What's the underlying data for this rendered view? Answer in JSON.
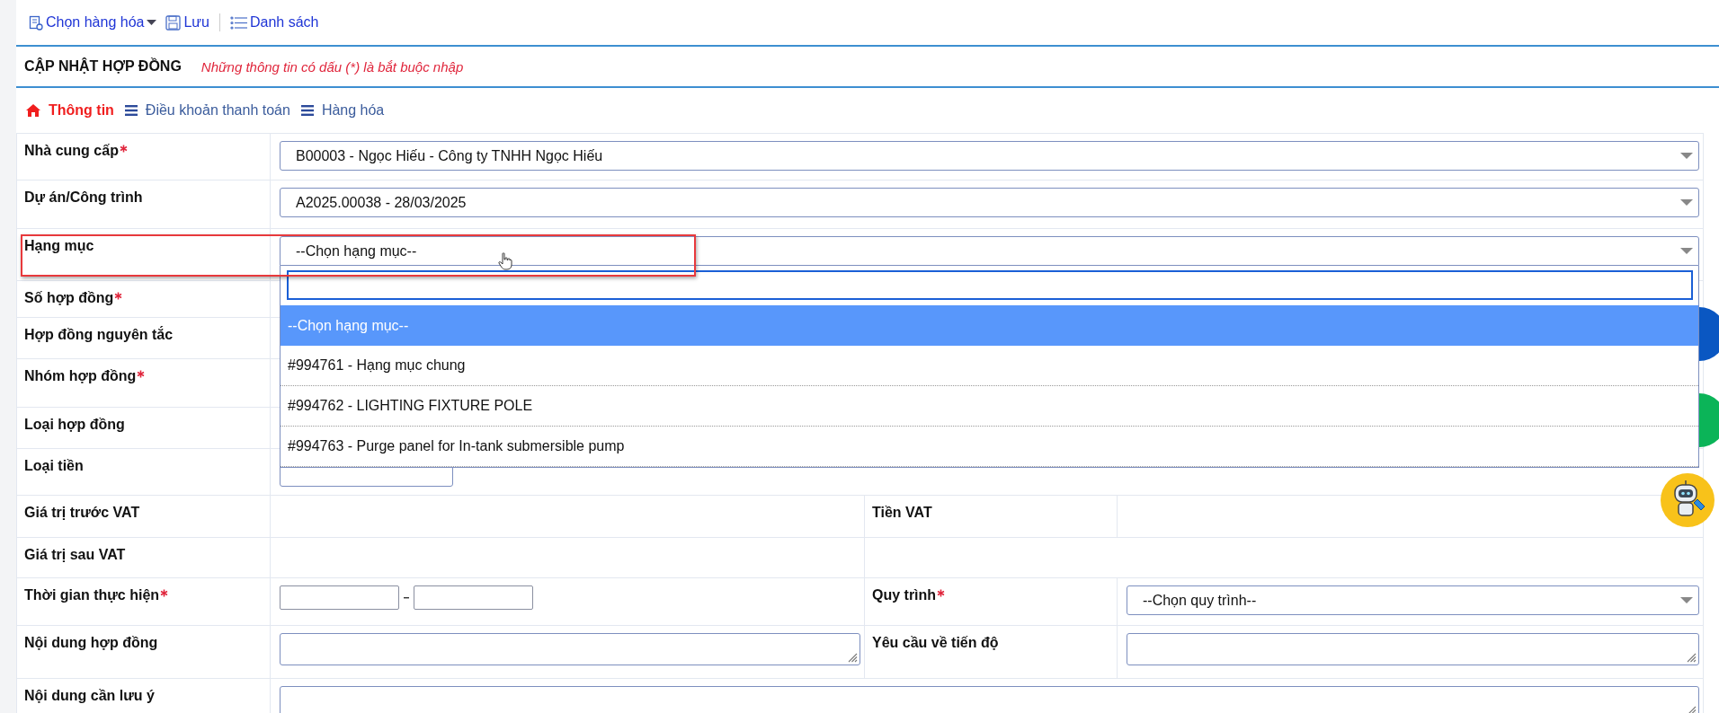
{
  "toolbar": [
    {
      "label": "Chọn hàng hóa",
      "kind": "menu"
    },
    {
      "label": "Lưu",
      "kind": "save"
    },
    {
      "label": "Danh sách",
      "kind": "list"
    }
  ],
  "header": {
    "title": "CẬP NHẬT HỢP ĐỒNG",
    "note": "Những thông tin có dấu (*) là bắt buộc nhập"
  },
  "tabs": [
    {
      "label": "Thông tin",
      "kind": "home",
      "selected": true
    },
    {
      "label": "Điều khoản thanh toán",
      "kind": "list",
      "selected": false
    },
    {
      "label": "Hàng hóa",
      "kind": "list",
      "selected": false
    }
  ],
  "form": {
    "rows": [
      {
        "label": "Nhà cung cấp",
        "required": true,
        "highlighted": false,
        "kind": "wide",
        "field": {
          "kind": "select",
          "open": false,
          "value": "B00003 - Ngọc Hiếu - Công ty TNHH Ngọc Hiếu"
        }
      },
      {
        "label": "Dự án/Công trình",
        "required": false,
        "highlighted": false,
        "kind": "wide",
        "field": {
          "kind": "select",
          "open": false,
          "value": "A2025.00038 - 28/03/2025"
        }
      },
      {
        "label": "Hạng mục",
        "required": false,
        "highlighted": true,
        "kind": "wide",
        "field": {
          "kind": "select",
          "open": true,
          "value": "--Chọn hạng mục--",
          "options": [
            {
              "label": "--Chọn hạng mục--",
              "selected": true
            },
            {
              "label": "#994761 - Hạng mục chung",
              "selected": false
            },
            {
              "label": "#994762 - LIGHTING FIXTURE POLE",
              "selected": false
            },
            {
              "label": "#994763 - Purge panel for In-tank submersible pump",
              "selected": false
            }
          ]
        }
      },
      {
        "label": "Số hợp đồng",
        "required": true,
        "highlighted": false,
        "kind": "wide"
      },
      {
        "label": "Hợp đồng nguyên tắc",
        "required": false,
        "highlighted": false,
        "kind": "wide"
      },
      {
        "label": "Nhóm hợp đồng",
        "required": true,
        "highlighted": false,
        "kind": "wide"
      },
      {
        "label": "Loại hợp đồng",
        "required": false,
        "highlighted": false,
        "kind": "wide"
      },
      {
        "label": "Loại tiền",
        "required": false,
        "highlighted": false,
        "kind": "wide",
        "field": {
          "kind": "short-select"
        }
      },
      {
        "label": "Giá trị trước VAT",
        "required": false,
        "highlighted": false,
        "kind": "split",
        "right": {
          "label": "Tiền VAT",
          "required": false
        }
      },
      {
        "label": "Giá trị sau VAT",
        "required": false,
        "highlighted": false,
        "kind": "half"
      },
      {
        "label": "Thời gian thực hiện",
        "required": true,
        "highlighted": false,
        "kind": "split",
        "field": {
          "kind": "daterange"
        },
        "right": {
          "label": "Quy trình",
          "required": true,
          "field": {
            "kind": "select",
            "open": false,
            "value": "--Chọn quy trình--"
          }
        }
      },
      {
        "label": "Nội dung hợp đồng",
        "required": false,
        "highlighted": false,
        "kind": "split",
        "field": {
          "kind": "textarea"
        },
        "right": {
          "label": "Yêu cầu về tiến độ",
          "required": false,
          "field": {
            "kind": "textarea"
          }
        }
      },
      {
        "label": "Nội dung cần lưu ý",
        "required": false,
        "highlighted": false,
        "kind": "wide",
        "field": {
          "kind": "textarea"
        }
      }
    ]
  }
}
